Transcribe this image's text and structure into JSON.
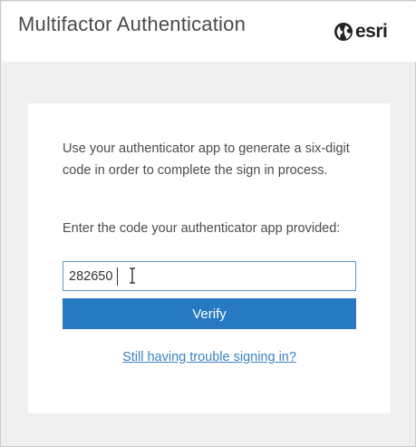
{
  "header": {
    "title": "Multifactor Authentication",
    "logo_text": "esri",
    "logo_icon": "globe-icon"
  },
  "form": {
    "instructions": "Use your authenticator app to generate a six-digit code in order to complete the sign in process.",
    "code_label": "Enter the code your authenticator app provided:",
    "code_value": "282650",
    "verify_label": "Verify",
    "help_link": "Still having trouble signing in?"
  },
  "colors": {
    "button": "#2779c1",
    "link": "#3a83c4",
    "input_border": "#5a9bbf",
    "background": "#f0f0f0"
  }
}
